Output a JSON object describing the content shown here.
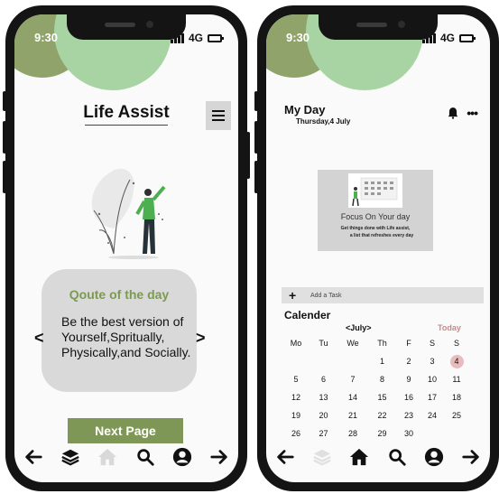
{
  "left_screen": {
    "status": {
      "time": "9:30",
      "network": "4G"
    },
    "app_title": "Life Assist",
    "quote": {
      "title": "Qoute of the day",
      "lines": [
        "Be the best version of",
        "Yourself,Spritually,",
        "Physically,and Socially."
      ]
    },
    "prev_label": "<",
    "next_label": ">",
    "next_button": "Next Page",
    "navbar": [
      "back-arrow-icon",
      "layers-icon",
      "home-icon",
      "search-icon",
      "profile-icon",
      "forward-arrow-icon"
    ]
  },
  "right_screen": {
    "status": {
      "time": "9:30",
      "network": "4G"
    },
    "title": "My Day",
    "date": "Thursday,4 July",
    "focus": {
      "title": "Focus On Your day",
      "subtitle_1": "Get things done with Life assist,",
      "subtitle_2": "a list that refreshes every day"
    },
    "add_task": {
      "icon": "+",
      "label": "Add a Task"
    },
    "calendar": {
      "title": "Calender",
      "month": "<July>",
      "today_label": "Today",
      "weekdays": [
        "Mo",
        "Tu",
        "We",
        "Th",
        "F",
        "S",
        "S"
      ],
      "weeks": [
        [
          "",
          "",
          "",
          "1",
          "2",
          "3",
          "4"
        ],
        [
          "5",
          "6",
          "7",
          "8",
          "9",
          "10",
          "11"
        ],
        [
          "12",
          "13",
          "14",
          "15",
          "16",
          "17",
          "18"
        ],
        [
          "19",
          "20",
          "21",
          "22",
          "23",
          "24",
          "25"
        ],
        [
          "26",
          "27",
          "28",
          "29",
          "30",
          "",
          ""
        ]
      ],
      "highlighted_day": "4"
    },
    "navbar": [
      "back-arrow-icon",
      "layers-icon",
      "home-icon",
      "search-icon",
      "profile-icon",
      "forward-arrow-icon"
    ]
  },
  "colors": {
    "accent_green": "#7f9756",
    "blob_dark": "#8fa36a",
    "blob_light": "#a8d4a4",
    "today_pink": "#c98888"
  }
}
